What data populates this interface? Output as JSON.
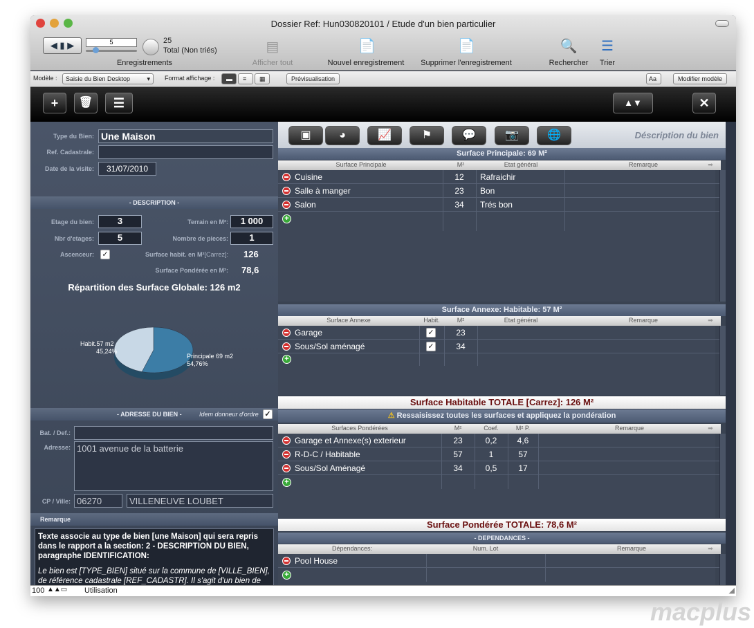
{
  "window": {
    "title": "Dossier Ref: Hun030820101 / Etude d'un bien particulier"
  },
  "toolbar": {
    "record_number": "5",
    "total_count": "25",
    "total_label": "Total (Non triés)",
    "records_label": "Enregistrements",
    "show_all": "Afficher tout",
    "new_record": "Nouvel enregistrement",
    "delete_record": "Supprimer l'enregistrement",
    "search": "Rechercher",
    "sort": "Trier"
  },
  "layoutbar": {
    "model_label": "Modèle :",
    "model_value": "Saisie du Bien Desktop",
    "format_label": "Format affichage :",
    "preview_label": "Prévisualisation",
    "aa_label": "Aa",
    "edit_model": "Modifier modèle"
  },
  "left": {
    "type_label": "Type du Bien:",
    "type_value": "Une Maison",
    "cadastre_label": "Ref. Cadastrale:",
    "cadastre_value": "",
    "date_label": "Date de la visite:",
    "date_value": "31/07/2010",
    "description_header": "- DESCRIPTION -",
    "floor_label": "Etage du bien:",
    "floor_value": "3",
    "land_label": "Terrain en M²:",
    "land_value": "1 000",
    "floors_label": "Nbr d'etages:",
    "floors_value": "5",
    "rooms_label": "Nombre de pieces:",
    "rooms_value": "1",
    "elevator_label": "Ascenceur:",
    "surf_hab_label": "Surface habit. en M²",
    "surf_hab_note": "[Carrez]:",
    "surf_hab_value": "126",
    "surf_pond_label": "Surface Pondérée en M²:",
    "surf_pond_value": "78,6",
    "repartition_title": "Répartition des Surface Globale: 126 m2",
    "address_header": "- ADRESSE DU BIEN -",
    "idem_label": "Idem donneur d'ordre",
    "bat_label": "Bat. / Def.:",
    "bat_value": "",
    "address_label": "Adresse:",
    "address_value": "1001 avenue de la batterie",
    "cp_label": "CP / Ville:",
    "cp_value": "06270",
    "city_value": "VILLENEUVE LOUBET",
    "remark_header": "Remarque",
    "remark_bold": "Texte associe au type de bien [une Maison] qui sera repris dans le rapport a la section: 2 - DESCRIPTION DU BIEN, paragraphe IDENTIFICATION:",
    "remark_italic": "Le bien est [TYPE_BIEN] situé sur la commune de [VILLE_BIEN], de référence cadastrale [REF_CADASTR]. Il s'agit d'un bien de [NBR_PIECE] pièces élevé sur un terrain"
  },
  "chart_data": {
    "type": "pie",
    "title": "Répartition des Surface Globale: 126 m2",
    "slices": [
      {
        "label": "Principale 69 m2",
        "pct_label": "54,76%",
        "value": 69,
        "color": "#3c7da6"
      },
      {
        "label": "Habit.57 m2",
        "pct_label": "45,24%",
        "value": 57,
        "color": "#c8d8e6"
      }
    ]
  },
  "right": {
    "desc_title": "Déscription du bien",
    "principale": {
      "title": "Surface Principale:  69 M²",
      "headers": [
        "Surface Principale",
        "M²",
        "Etat général",
        "Remarque"
      ],
      "rows": [
        {
          "name": "Cuisine",
          "m2": "12",
          "etat": "Rafraichir",
          "rem": ""
        },
        {
          "name": "Salle à manger",
          "m2": "23",
          "etat": "Bon",
          "rem": ""
        },
        {
          "name": "Salon",
          "m2": "34",
          "etat": "Trés bon",
          "rem": ""
        }
      ]
    },
    "annexe": {
      "title": "Surface Annexe: Habitable: 57 M²",
      "headers": [
        "Surface Annexe",
        "Habit.",
        "M²",
        "Etat général",
        "Remarque"
      ],
      "rows": [
        {
          "name": "Garage",
          "m2": "23"
        },
        {
          "name": "Sous/Sol aménagé",
          "m2": "34"
        }
      ]
    },
    "total_hab": "Surface Habitable TOTALE [Carrez]: 126 M²",
    "warning": "Ressaisissez toutes les surfaces et appliquez la pondération",
    "ponderees": {
      "headers": [
        "Surfaces Pondérées",
        "M²",
        "Coef.",
        "M² P.",
        "Remarque"
      ],
      "rows": [
        {
          "name": "Garage et Annexe(s) exterieur",
          "m2": "23",
          "coef": "0,2",
          "mp": "4,6"
        },
        {
          "name": "R-D-C / Habitable",
          "m2": "57",
          "coef": "1",
          "mp": "57"
        },
        {
          "name": "Sous/Sol Aménagé",
          "m2": "34",
          "coef": "0,5",
          "mp": "17"
        }
      ]
    },
    "total_pond": "Surface Pondérée TOTALE: 78,6 M²",
    "dependances": {
      "title": "- DEPENDANCES -",
      "headers": [
        "Dépendances:",
        "Num. Lot",
        "Remarque"
      ],
      "rows": [
        {
          "name": "Pool House"
        }
      ]
    }
  },
  "status": {
    "zoom": "100",
    "mode": "Utilisation"
  },
  "watermark": "macplus"
}
